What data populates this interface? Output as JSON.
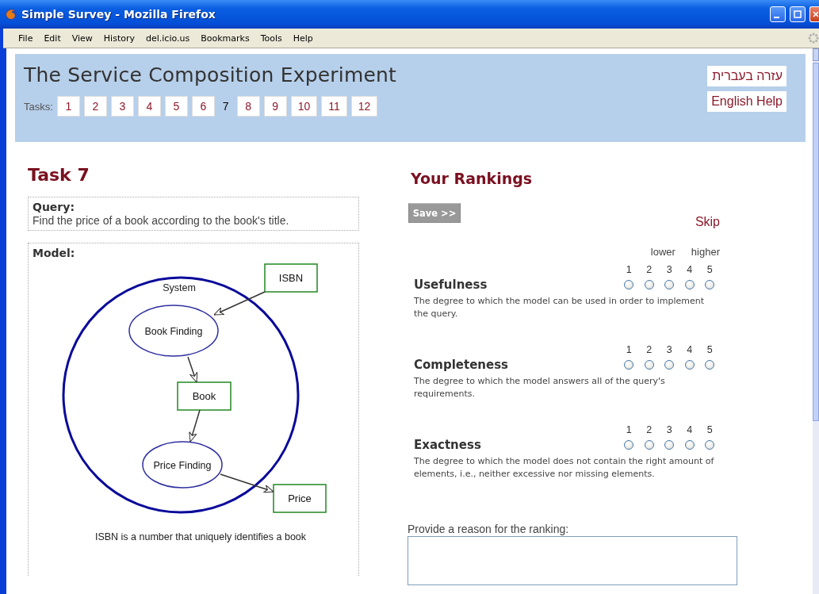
{
  "window": {
    "title": "Simple Survey - Mozilla Firefox"
  },
  "menu": [
    "File",
    "Edit",
    "View",
    "History",
    "del.icio.us",
    "Bookmarks",
    "Tools",
    "Help"
  ],
  "header": {
    "title": "The Service Composition Experiment",
    "tasks_label": "Tasks:",
    "tasks": [
      {
        "label": "1",
        "selected": false
      },
      {
        "label": "2",
        "selected": false
      },
      {
        "label": "3",
        "selected": false
      },
      {
        "label": "4",
        "selected": false
      },
      {
        "label": "5",
        "selected": false
      },
      {
        "label": "6",
        "selected": false
      },
      {
        "label": "7",
        "selected": true
      },
      {
        "label": "8",
        "selected": false
      },
      {
        "label": "9",
        "selected": false
      },
      {
        "label": "10",
        "selected": false
      },
      {
        "label": "11",
        "selected": false
      },
      {
        "label": "12",
        "selected": false
      }
    ],
    "help_links": [
      "עזרה בעברית",
      "English Help"
    ]
  },
  "task": {
    "title": "Task 7",
    "query_label": "Query:",
    "query": "Find the price of a book according to the book's title.",
    "model_label": "Model:",
    "diagram": {
      "nodes": [
        {
          "kind": "system",
          "label": "System"
        },
        {
          "kind": "data",
          "label": "ISBN"
        },
        {
          "kind": "process",
          "label": "Book Finding"
        },
        {
          "kind": "data",
          "label": "Book"
        },
        {
          "kind": "process",
          "label": "Price Finding"
        },
        {
          "kind": "data",
          "label": "Price"
        }
      ],
      "caption": "ISBN is a number that uniquely identifies a book"
    }
  },
  "rankings": {
    "title": "Your Rankings",
    "save": "Save >>",
    "skip": "Skip",
    "criteria": [
      {
        "name": "Usefulness",
        "description": "The degree to which the model can be used in order to implement the query.",
        "low_label": "lower",
        "high_label": "higher",
        "options": [
          {
            "label": "1",
            "selected": false
          },
          {
            "label": "2",
            "selected": false
          },
          {
            "label": "3",
            "selected": false
          },
          {
            "label": "4",
            "selected": false
          },
          {
            "label": "5",
            "selected": false
          }
        ]
      },
      {
        "name": "Completeness",
        "description": "The degree to which the model answers all of the query's requirements.",
        "options": [
          {
            "label": "1",
            "selected": false
          },
          {
            "label": "2",
            "selected": false
          },
          {
            "label": "3",
            "selected": false
          },
          {
            "label": "4",
            "selected": false
          },
          {
            "label": "5",
            "selected": false
          }
        ]
      },
      {
        "name": "Exactness",
        "description": "The degree to which the model does not contain the right amount of elements, i.e., neither excessive nor missing elements.",
        "options": [
          {
            "label": "1",
            "selected": false
          },
          {
            "label": "2",
            "selected": false
          },
          {
            "label": "3",
            "selected": false
          },
          {
            "label": "4",
            "selected": false
          },
          {
            "label": "5",
            "selected": false
          }
        ]
      }
    ],
    "reason_label": "Provide a reason for the ranking:"
  }
}
